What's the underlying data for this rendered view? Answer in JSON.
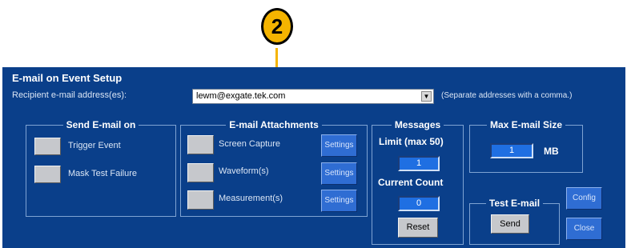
{
  "callout": {
    "number": "2"
  },
  "title": "E-mail on Event Setup",
  "recipient": {
    "label": "Recipient e-mail address(es):",
    "value": "lewm@exgate.tek.com",
    "hint": "(Separate addresses with a comma.)"
  },
  "send_email_on": {
    "legend": "Send E-mail on",
    "items": [
      "Trigger Event",
      "Mask Test Failure"
    ]
  },
  "attachments": {
    "legend": "E-mail Attachments",
    "items": [
      "Screen Capture",
      "Waveform(s)",
      "Measurement(s)"
    ],
    "settings_label": "Settings"
  },
  "messages": {
    "legend": "Messages",
    "limit_label": "Limit (max 50)",
    "limit_value": "1",
    "count_label": "Current Count",
    "count_value": "0",
    "reset_label": "Reset"
  },
  "max_size": {
    "legend": "Max E-mail Size",
    "value": "1",
    "unit": "MB"
  },
  "test_email": {
    "legend": "Test E-mail",
    "send_label": "Send"
  },
  "config_label": "Config",
  "close_label": "Close",
  "colors": {
    "panel": "#0a3f8a",
    "callout_fill": "#f5b400",
    "button_gray": "#c6c8cc",
    "settings_blue": "#2f6dd3"
  }
}
